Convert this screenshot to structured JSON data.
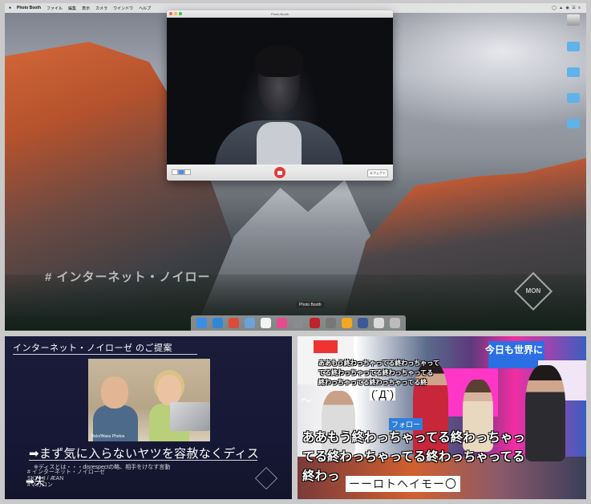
{
  "desktop": {
    "menubar": {
      "app_name": "Photo Booth",
      "menus": [
        "ファイル",
        "編集",
        "表示",
        "カメラ",
        "ウインドウ",
        "ヘルプ"
      ],
      "status": "◯ ▲ ◉ ☰ ≡"
    },
    "watermark_hashtag": "#  インターネット・ノイロー",
    "logo_text": "MON",
    "photo_booth": {
      "window_title": "Photo Booth",
      "effects_label": "エフェクト",
      "traffic_colors": [
        "#ff5f57",
        "#febc2e",
        "#28c840"
      ]
    },
    "dock": {
      "tooltip": "Photo Booth",
      "icons": [
        {
          "name": "finder-icon",
          "color": "#3a8ee6"
        },
        {
          "name": "safari-icon",
          "color": "#2d88d8"
        },
        {
          "name": "chrome-icon",
          "color": "#dd4b39"
        },
        {
          "name": "preview-icon",
          "color": "#6aa3d8"
        },
        {
          "name": "textedit-icon",
          "color": "#f3f3f3"
        },
        {
          "name": "itunes-icon",
          "color": "#e84a8f"
        },
        {
          "name": "system-preferences-icon",
          "color": "#8a8a8f"
        },
        {
          "name": "photo-booth-icon",
          "color": "#c0212b"
        },
        {
          "name": "downloads-icon",
          "color": "#777"
        },
        {
          "name": "photos-icon",
          "color": "#f5a623"
        },
        {
          "name": "quicktime-icon",
          "color": "#3b5998"
        },
        {
          "name": "screenshot-icon",
          "color": "#dadada"
        },
        {
          "name": "trash-icon",
          "color": "#bbbbbb"
        }
      ]
    }
  },
  "slide": {
    "title": "インターネット・ノイローゼ のご提案",
    "photo_credit": "flickr/Wasu Photos",
    "main_text": "➡まず気に入らないヤツを容赦なくディス",
    "note": "※ディスとは・・・disrespectの略、相手をけなす言動",
    "overlay_small": "# インターネット・ノイローゼ\nSKY-HI / ÆAN\n#マカロン",
    "overlay_arrow": "➡失"
  },
  "music_video": {
    "lyric_1": "ああもう終わっちゃってる終わっちゃって",
    "lyric_2": "てる終わっちゃってる終わっちゃってる",
    "lyric_3": "終わっちゃってる終わっちゃってる終",
    "lyric_big_1": "ああもう終わっちゃってる終わっちゃっ",
    "lyric_big_2": "てる終わっちゃってる終わっちゃってる",
    "lyric_big_3": "終わっ",
    "kaomoji": "(´Д`)",
    "follow": "フォロー",
    "banner": "今日も世界に",
    "tilde": "〜",
    "caption": "ーーロトヘイモー〇"
  }
}
